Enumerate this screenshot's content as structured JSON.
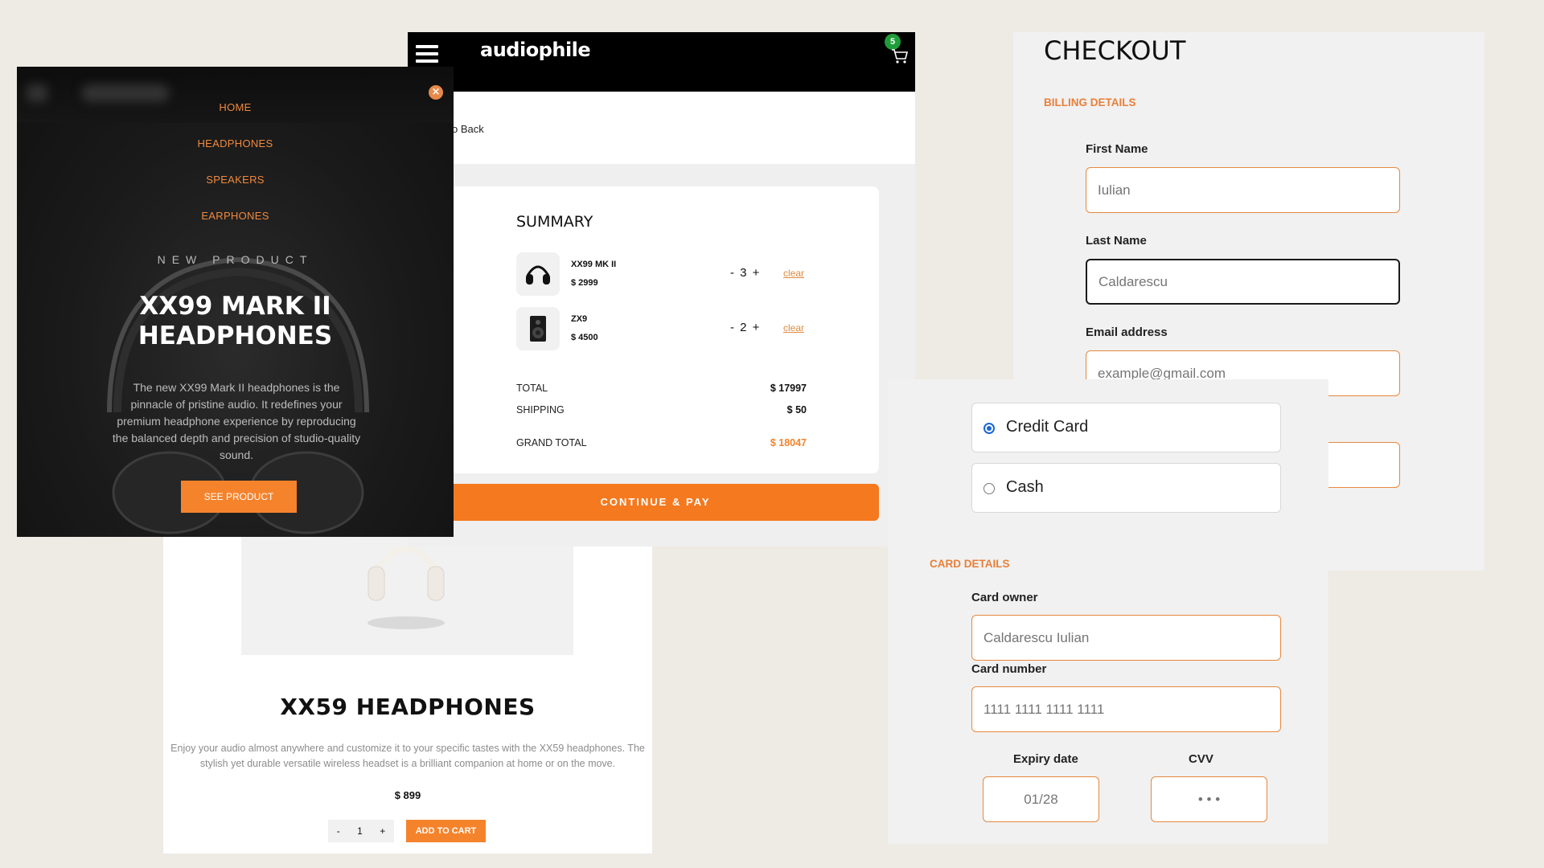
{
  "product": {
    "title": "XX59 HEADPHONES",
    "description": "Enjoy your audio almost anywhere and customize it to your specific tastes with the XX59 headphones. The stylish yet durable versatile wireless headset is a brilliant companion at home or on the move.",
    "price": "$ 899",
    "qty_minus": "-",
    "qty_value": "1",
    "qty_plus": "+",
    "add_to_cart": "ADD TO CART"
  },
  "cart": {
    "logo": "audiophile",
    "badge_count": "5",
    "back_label": "o Back",
    "summary_title": "SUMMARY",
    "items": [
      {
        "name": "XX99 MK II",
        "price": "$ 2999",
        "qty": "- 3 +",
        "clear": "clear"
      },
      {
        "name": "ZX9",
        "price": "$ 4500",
        "qty": "- 2 +",
        "clear": "clear"
      }
    ],
    "total_label": "TOTAL",
    "total_value": "$ 17997",
    "shipping_label": "SHIPPING",
    "shipping_value": "$ 50",
    "grand_total_label": "GRAND TOTAL",
    "grand_total_value": "$ 18047",
    "continue_label": "CONTINUE & PAY"
  },
  "menu": {
    "links": [
      "HOME",
      "HEADPHONES",
      "SPEAKERS",
      "EARPHONES"
    ],
    "close_glyph": "×",
    "eyebrow": "NEW PRODUCT",
    "hero_title": "XX99 MARK II\nHEADPHONES",
    "hero_description": "The new XX99 Mark II headphones is the pinnacle of pristine audio. It redefines your premium headphone experience by reproducing the balanced depth and precision of studio-quality sound.",
    "cta": "SEE PRODUCT"
  },
  "checkout": {
    "title": "CHECKOUT",
    "billing_heading": "BILLING DETAILS",
    "first_name_label": "First Name",
    "first_name_placeholder": "Iulian",
    "last_name_label": "Last Name",
    "last_name_placeholder": "Caldarescu",
    "email_label": "Email address",
    "email_placeholder": "example@gmail.com"
  },
  "payment": {
    "options": [
      "Credit Card",
      "Cash"
    ],
    "selected": "Credit Card",
    "card_details_heading": "CARD DETAILS",
    "card_owner_label": "Card owner",
    "card_owner_placeholder": "Caldarescu Iulian",
    "card_number_label": "Card number",
    "card_number_placeholder": "1111 1111 1111 1111",
    "expiry_label": "Expiry date",
    "expiry_placeholder": "01/28",
    "cvv_label": "CVV",
    "cvv_placeholder": "• • •"
  },
  "colors": {
    "accent": "#f5832c",
    "background": "#eeeae4",
    "header_black": "#000000",
    "badge_green": "#1f9d3a",
    "radio_blue": "#1a66d8"
  },
  "icons": [
    "hamburger-icon",
    "cart-icon",
    "close-icon",
    "headphones-icon",
    "speaker-icon"
  ]
}
